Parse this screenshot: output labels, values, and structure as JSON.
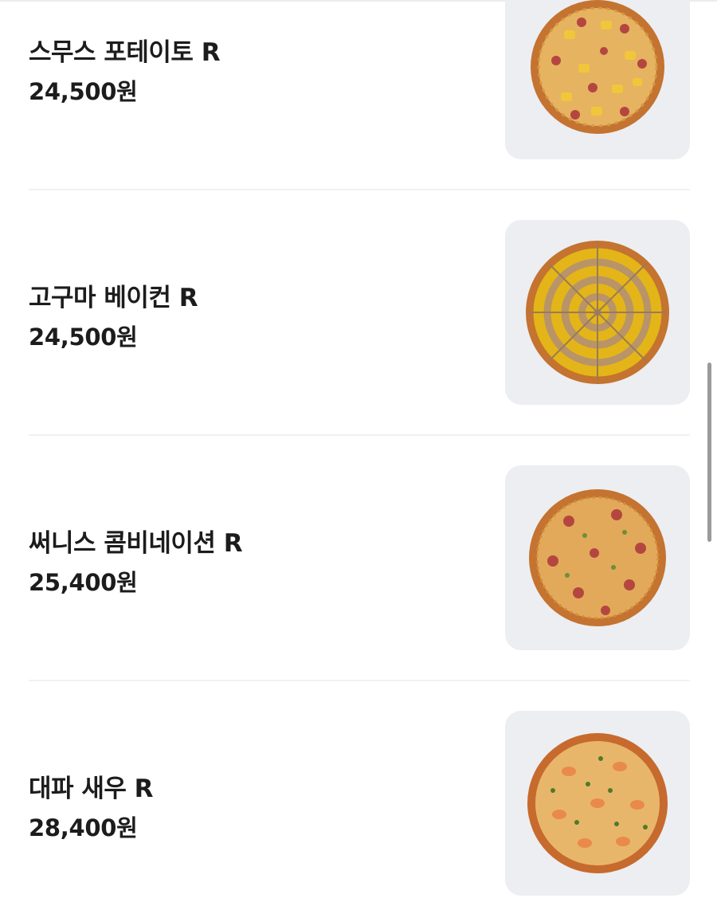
{
  "menu": {
    "items": [
      {
        "name": "스무스 포테이토 R",
        "price": "24,500원",
        "image_icon": "pizza-potato-image"
      },
      {
        "name": "고구마 베이컨 R",
        "price": "24,500원",
        "image_icon": "pizza-sweet-potato-image"
      },
      {
        "name": "써니스 콤비네이션 R",
        "price": "25,400원",
        "image_icon": "pizza-combination-image"
      },
      {
        "name": "대파 새우 R",
        "price": "28,400원",
        "image_icon": "pizza-shrimp-image"
      }
    ]
  },
  "colors": {
    "background": "#ffffff",
    "text": "#1c1c1c",
    "thumb_bg": "#eceef2",
    "divider": "#f1f1f1",
    "crust": "#c9782f",
    "cheese": "#e8b65a",
    "sweet_potato": "#e3b518",
    "pepperoni": "#b5463f"
  }
}
